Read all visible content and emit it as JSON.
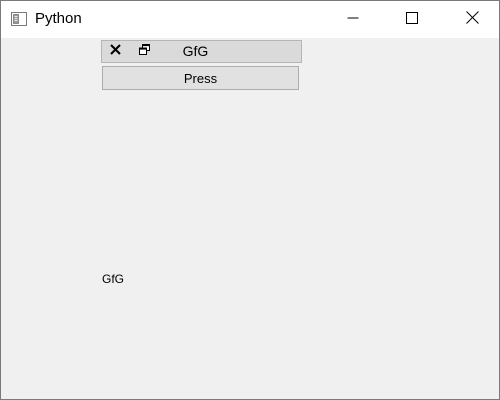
{
  "window": {
    "title": "Python",
    "controls": {
      "minimize_icon": "minimize-icon",
      "maximize_icon": "maximize-icon",
      "close_icon": "close-icon"
    }
  },
  "dock": {
    "title": "GfG",
    "close_icon": "close-icon",
    "float_icon": "float-icon"
  },
  "press_button": {
    "label": "Press"
  },
  "label": {
    "text": "GfG"
  },
  "colors": {
    "window_background": "#f0f0f0",
    "titlebar_background": "#ffffff",
    "dock_title_background": "#dadada",
    "button_background": "#e1e1e1"
  }
}
